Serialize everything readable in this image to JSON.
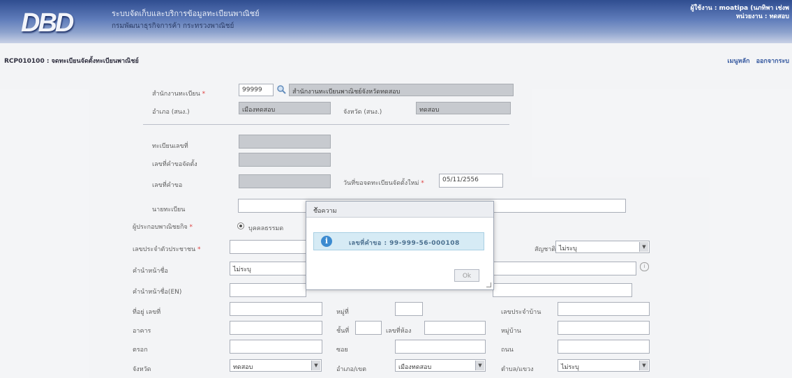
{
  "header": {
    "logo": "DBD",
    "system_title": "ระบบจัดเก็บและบริการข้อมูลทะเบียนพาณิชย์",
    "department": "กรมพัฒนาธุรกิจการค้า กระทรวงพาณิชย์",
    "user_line": "ผู้ใช้งาน : moatipa (นภทิพา เช่งพ",
    "unit_line": "หน่วยงาน : ทดสอบ"
  },
  "page": {
    "code_title": "RCP010100 : จดทะเบียนจัดตั้งทะเบียนพาณิชย์",
    "links": "เมนูหลัก ออกจากระบ"
  },
  "form": {
    "office_label": "สำนักงานทะเบียน",
    "office_code": "99999",
    "office_name": "สำนักงานทะเบียนพาณิชย์จังหวัดทดสอบ",
    "amphoe_label": "อำเภอ (สนง.)",
    "amphoe_value": "เมืองทดสอบ",
    "province_label": "จังหวัด (สนง.)",
    "province_value": "ทดสอบ",
    "reg_no_label": "ทะเบียนเลขที่",
    "req_no_label": "เลขที่คำขอจัดตั้ง",
    "app_no_label": "เลขที่คำขอ",
    "new_date_label": "วันที่ขอจดทะเบียนจัดตั้งใหม่",
    "new_date_value": "05/11/2556",
    "registrar_label": "นายทะเบียน",
    "operator_label": "ผู้ประกอบพาณิชยกิจ",
    "operator_option": "บุคคลธรรมด",
    "id_label": "เลขประจำตัวประชาชน",
    "nationality_label": "สัญชาติ",
    "nationality_value": "ไม่ระบุ",
    "title_label": "คำนำหน้าชื่อ",
    "title_value": "ไม่ระบุ",
    "title_en_label": "คำนำหน้าชื่อ(EN)",
    "address_label": "ที่อยู่ เลขที่",
    "moo_label": "หมู่ที่",
    "house_id_label": "เลขประจำบ้าน",
    "building_label": "อาคาร",
    "floor_label": "ชั้นที่",
    "room_label": "เลขที่ห้อง",
    "village_label": "หมู่บ้าน",
    "soi_label": "ตรอก",
    "alley_label": "ซอย",
    "road_label": "ถนน",
    "prov_label": "จังหวัด",
    "prov_value": "ทดสอบ",
    "district_label": "อำเภอ/เขต",
    "district_value": "เมืองทดสอบ",
    "subdistrict_label": "ตำบล/แขวง",
    "subdistrict_value": "ไม่ระบุ",
    "required_mark": "*"
  },
  "dialog": {
    "title": "ข้อความ",
    "close": "×",
    "message": "เลขที่คำขอ : 99-999-56-000108",
    "ok": "Ok",
    "info_icon": "i"
  },
  "colors": {
    "header_dark": "#2f4d90",
    "header_light": "#c9d2e6",
    "info_bg": "#d6ebf5",
    "info_icon": "#3c8bd0"
  }
}
